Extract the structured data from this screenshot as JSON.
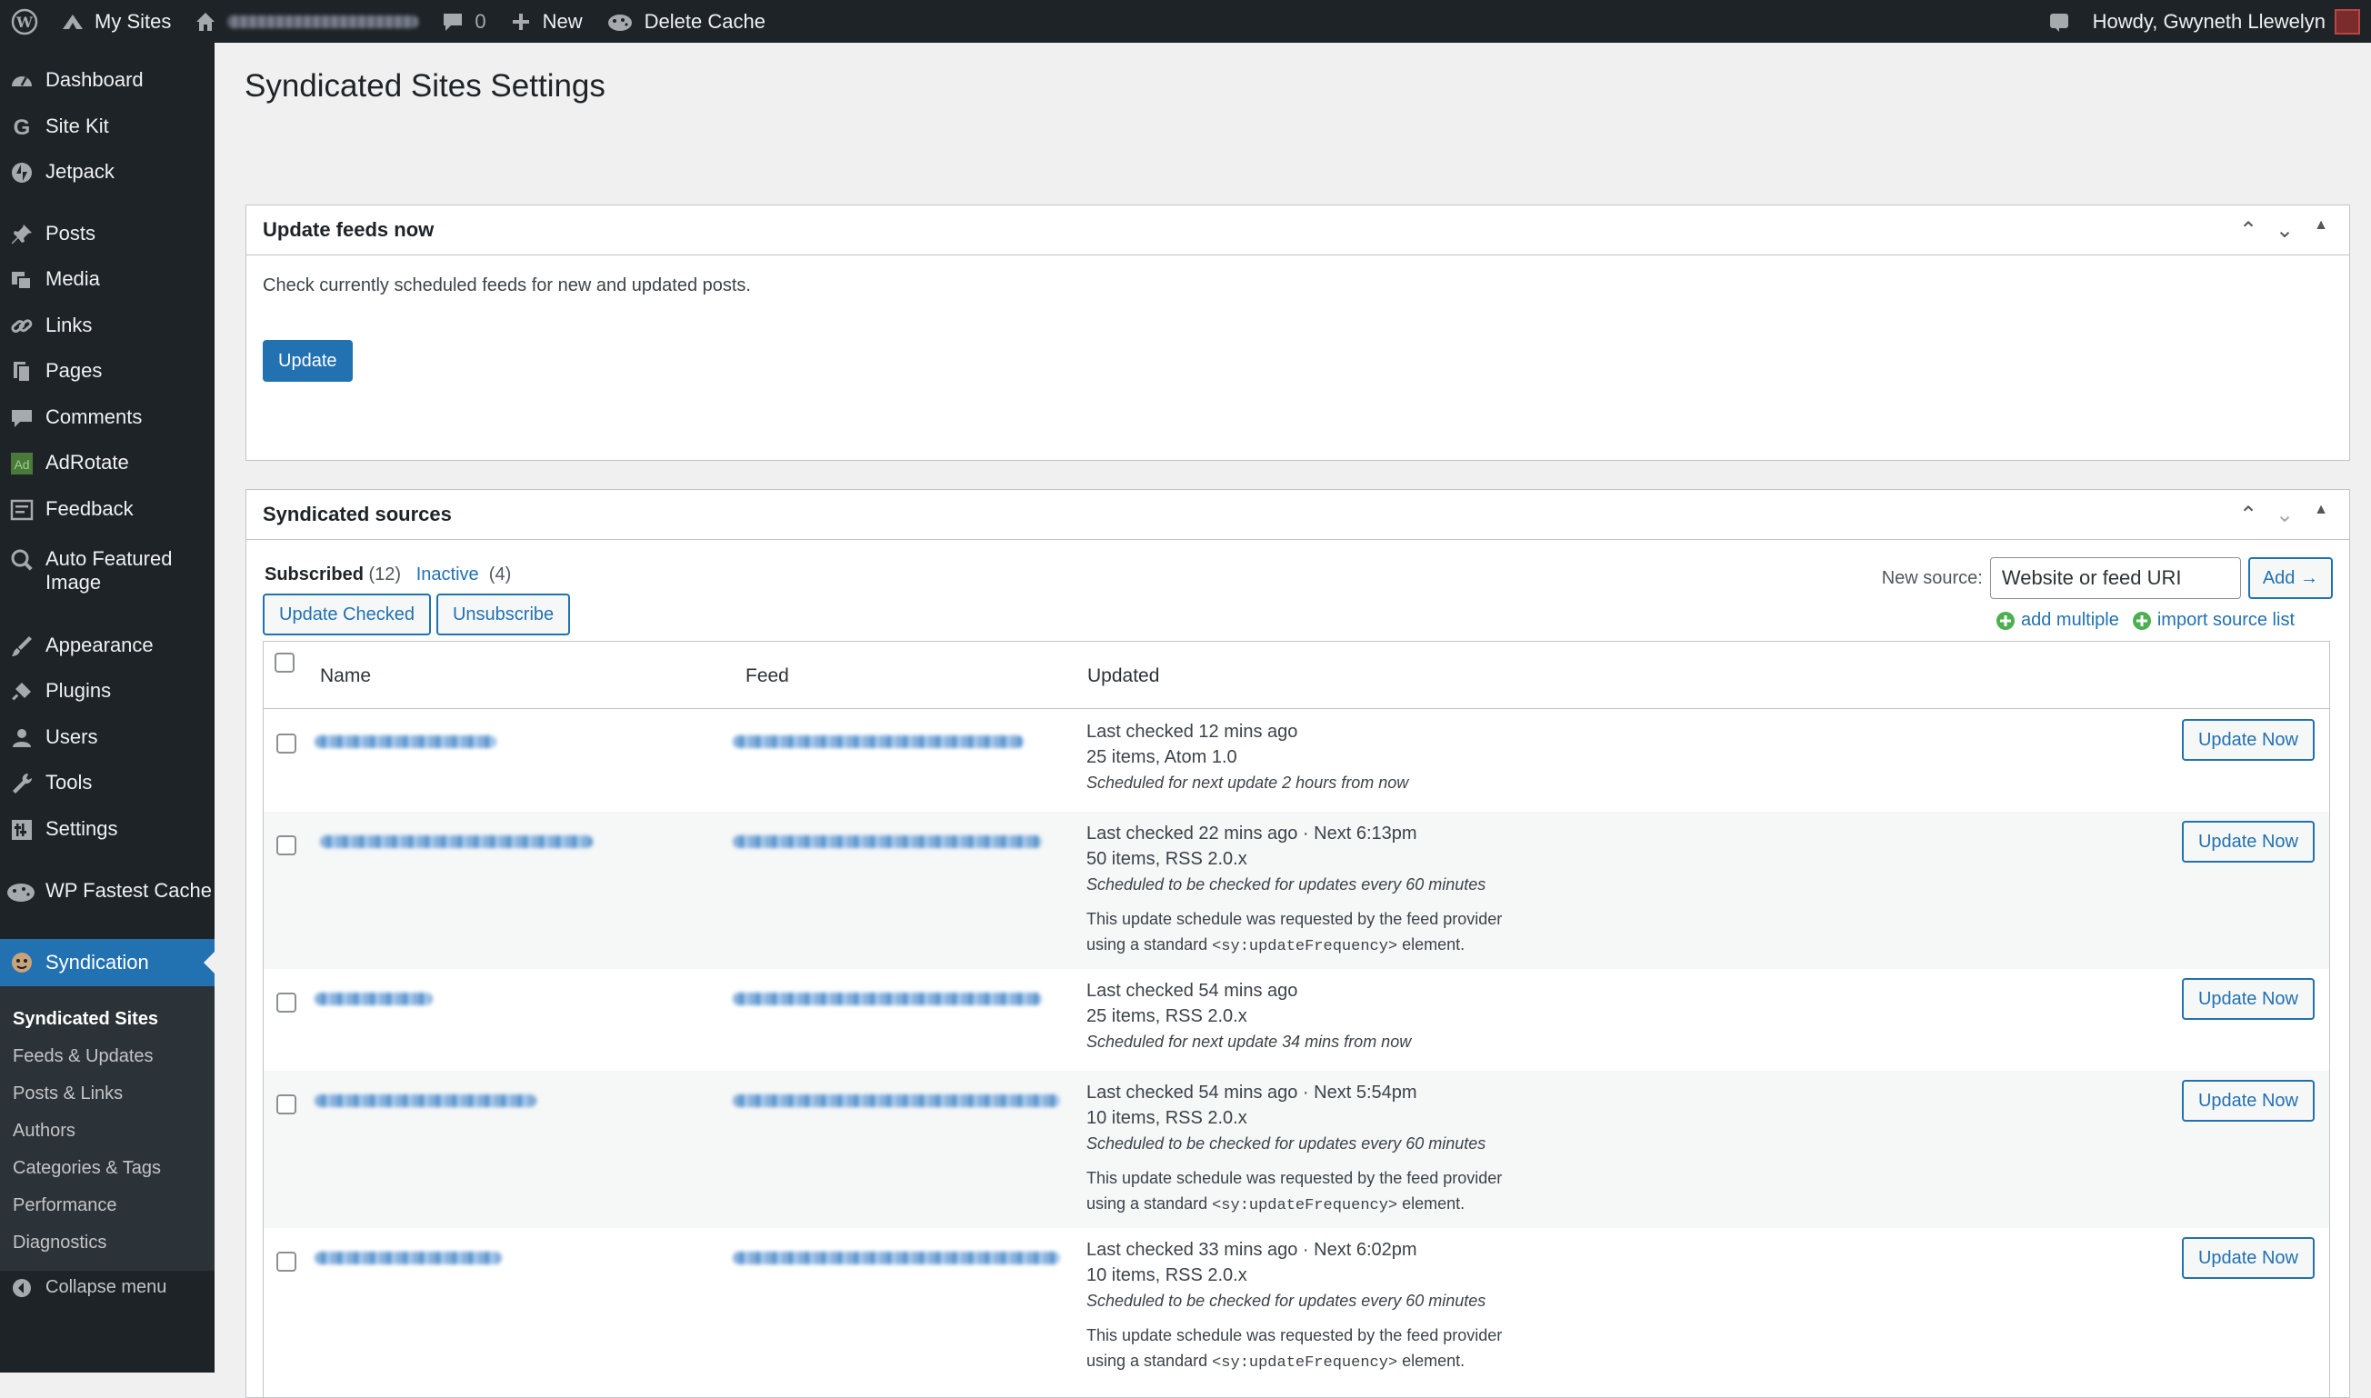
{
  "adminbar": {
    "my_sites": "My Sites",
    "comments_count": "0",
    "new": "New",
    "delete_cache": "Delete Cache",
    "howdy": "Howdy, Gwyneth Llewelyn"
  },
  "sidebar": {
    "items": [
      {
        "label": "Dashboard"
      },
      {
        "label": "Site Kit"
      },
      {
        "label": "Jetpack"
      },
      {
        "label": "Posts"
      },
      {
        "label": "Media"
      },
      {
        "label": "Links"
      },
      {
        "label": "Pages"
      },
      {
        "label": "Comments"
      },
      {
        "label": "AdRotate"
      },
      {
        "label": "Feedback"
      },
      {
        "label": "Auto Featured Image"
      },
      {
        "label": "Appearance"
      },
      {
        "label": "Plugins"
      },
      {
        "label": "Users"
      },
      {
        "label": "Tools"
      },
      {
        "label": "Settings"
      },
      {
        "label": "WP Fastest Cache"
      },
      {
        "label": "Syndication"
      }
    ],
    "submenu": [
      "Syndicated Sites",
      "Feeds & Updates",
      "Posts & Links",
      "Authors",
      "Categories & Tags",
      "Performance",
      "Diagnostics"
    ],
    "collapse": "Collapse menu"
  },
  "page": {
    "title": "Syndicated Sites Settings"
  },
  "update_box": {
    "title": "Update feeds now",
    "description": "Check currently scheduled feeds for new and updated posts.",
    "button": "Update"
  },
  "sources_box": {
    "title": "Syndicated sources",
    "filter_subscribed": "Subscribed",
    "subscribed_count": "(12)",
    "filter_inactive": "Inactive",
    "inactive_count": "(4)",
    "update_checked": "Update Checked",
    "unsubscribe": "Unsubscribe",
    "new_source_label": "New source:",
    "new_source_value": "Website or feed URI",
    "add_button": "Add →",
    "add_multiple": "add multiple",
    "import_source_list": "import source list",
    "columns": {
      "name": "Name",
      "feed": "Feed",
      "updated": "Updated"
    },
    "update_now": "Update Now",
    "rows": [
      {
        "line1": "Last checked 12 mins ago",
        "line2": "25 items, Atom 1.0",
        "line3": "Scheduled for next update 2 hours from now",
        "note1": "",
        "note2_a": "",
        "note2_code": "",
        "note2_b": ""
      },
      {
        "line1": "Last checked 22 mins ago · Next 6:13pm",
        "line2": "50 items, RSS 2.0.x",
        "line3": "Scheduled to be checked for updates every 60 minutes",
        "note1": "This update schedule was requested by the feed provider",
        "note2_a": "using a standard ",
        "note2_code": "<sy:updateFrequency>",
        "note2_b": " element."
      },
      {
        "line1": "Last checked 54 mins ago",
        "line2": "25 items, RSS 2.0.x",
        "line3": "Scheduled for next update 34 mins from now",
        "note1": "",
        "note2_a": "",
        "note2_code": "",
        "note2_b": ""
      },
      {
        "line1": "Last checked 54 mins ago · Next 5:54pm",
        "line2": "10 items, RSS 2.0.x",
        "line3": "Scheduled to be checked for updates every 60 minutes",
        "note1": "This update schedule was requested by the feed provider",
        "note2_a": "using a standard ",
        "note2_code": "<sy:updateFrequency>",
        "note2_b": " element."
      },
      {
        "line1": "Last checked 33 mins ago · Next 6:02pm",
        "line2": "10 items, RSS 2.0.x",
        "line3": "Scheduled to be checked for updates every 60 minutes",
        "note1": "This update schedule was requested by the feed provider",
        "note2_a": "using a standard ",
        "note2_code": "<sy:updateFrequency>",
        "note2_b": " element."
      }
    ]
  },
  "colors": {
    "accent": "#2271b1",
    "adminbar": "#1d2327",
    "sidebar_sub": "#2c3338",
    "page_bg": "#f0f0f1"
  }
}
